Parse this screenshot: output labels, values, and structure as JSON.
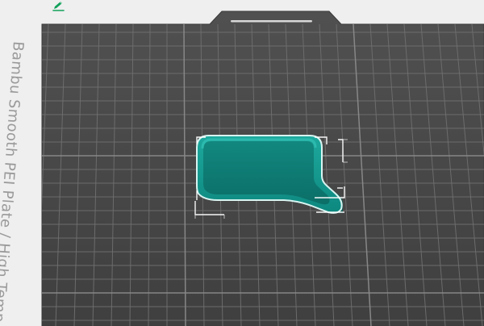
{
  "plate": {
    "label": "Bambu Smooth PEI Plate / High Temp Plate"
  },
  "toolbar": {
    "edit_icon": "edit-icon"
  },
  "colors": {
    "background": "#efefef",
    "plate": "#4a4a4a",
    "grid": "#7a7a7a",
    "object": "#0f8f84",
    "object_shadow": "#0b6f67",
    "handle": "#2b2b2b",
    "edit_icon": "#12a05a"
  }
}
